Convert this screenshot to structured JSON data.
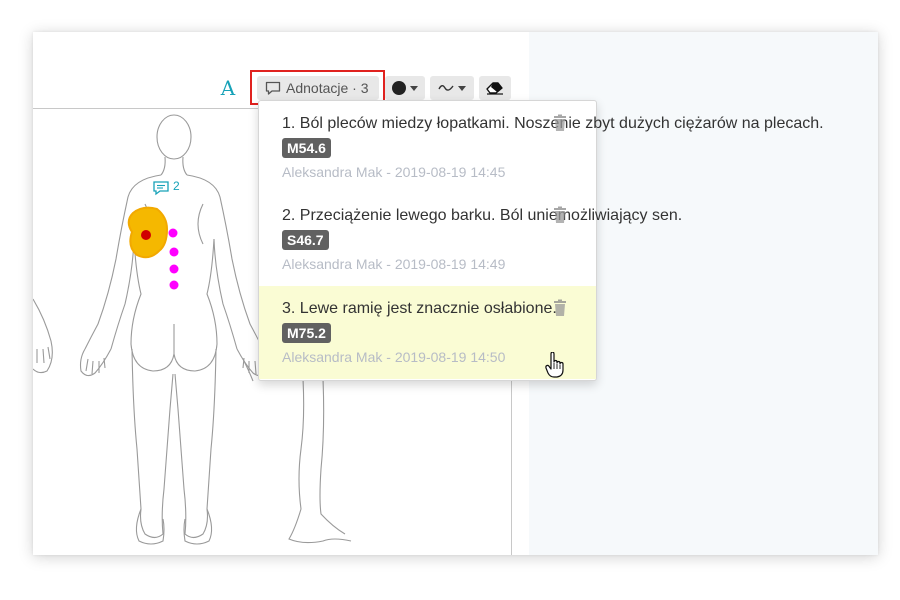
{
  "toolbar": {
    "text_tool_label": "A",
    "annotations_button_label": "Adnotacje · 3",
    "color_icon": "filled-circle",
    "stroke_icon": "wave",
    "eraser_icon": "eraser"
  },
  "colors": {
    "accent": "#17a2b8",
    "highlight_border": "#e0221f",
    "pain_area": "#f5b800",
    "pain_point": "#d00000",
    "spine_dots": "#ff00ff",
    "selected_row": "#fafcd4",
    "badge_bg": "#616161"
  },
  "canvas": {
    "marker_count": "2"
  },
  "annotations": [
    {
      "text": "1. Ból pleców miedzy łopatkami. Noszenie zbyt dużych ciężarów na plecach.",
      "code": "M54.6",
      "author_date": "Aleksandra Mak - 2019-08-19 14:45"
    },
    {
      "text": "2. Przeciążenie lewego barku. Ból uniemożliwiający sen.",
      "code": "S46.7",
      "author_date": "Aleksandra Mak - 2019-08-19 14:49"
    },
    {
      "text": "3. Lewe ramię jest znacznie osłabione.",
      "code": "M75.2",
      "author_date": "Aleksandra Mak - 2019-08-19 14:50"
    }
  ]
}
